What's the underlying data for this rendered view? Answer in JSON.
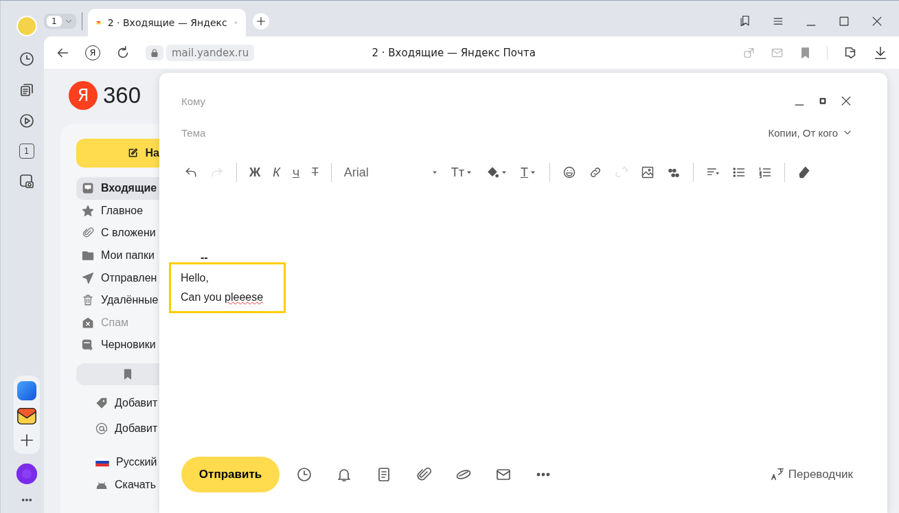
{
  "rail": {
    "top": [
      {
        "kind": "avatar"
      },
      {
        "kind": "clock"
      },
      {
        "kind": "tabs"
      },
      {
        "kind": "play"
      },
      {
        "kind": "counter",
        "label": "1"
      },
      {
        "kind": "screenshot"
      }
    ],
    "bottom": [
      {
        "kind": "app-blue"
      },
      {
        "kind": "app-mail"
      },
      {
        "kind": "plus"
      }
    ],
    "assistant": {
      "kind": "assistant"
    },
    "more": {
      "kind": "dots"
    }
  },
  "tab_strip": {
    "tab_count": "1",
    "tabs": [
      {
        "title": "2 · Входящие — Яндекс",
        "selected": true
      }
    ]
  },
  "address_bar": {
    "search_label": "Я",
    "url": "mail.yandex.ru",
    "page_title": "2 · Входящие — Яндекс Почта"
  },
  "logo": {
    "mark": "Я",
    "text": "360"
  },
  "sidebar": {
    "compose_button": "На",
    "folders": [
      {
        "label": "Входящие",
        "kind": "inbox",
        "selected": true,
        "muted": false
      },
      {
        "label": "Главное",
        "kind": "star",
        "selected": false,
        "muted": false
      },
      {
        "label": "С вложени",
        "kind": "clip",
        "selected": false,
        "muted": false
      },
      {
        "label": "Мои папки",
        "kind": "folder",
        "selected": false,
        "muted": false
      },
      {
        "label": "Отправлен",
        "kind": "send",
        "selected": false,
        "muted": false
      },
      {
        "label": "Удалённые",
        "kind": "trash",
        "selected": false,
        "muted": false
      },
      {
        "label": "Спам",
        "kind": "spam",
        "selected": false,
        "muted": true
      },
      {
        "label": "Черновики",
        "kind": "drafts",
        "selected": false,
        "muted": false
      }
    ],
    "extras": [
      {
        "label": "Добавит",
        "kind": "tag"
      },
      {
        "label": "Добавит",
        "kind": "at"
      }
    ],
    "links": [
      {
        "label": "Русский",
        "kind": "flag"
      },
      {
        "label": "Скачать",
        "kind": "android"
      }
    ]
  },
  "compose": {
    "to": {
      "placeholder": "Кому"
    },
    "subject": {
      "placeholder": "Тема"
    },
    "cc_toggle": "Копии, От кого",
    "toolbar": [
      [
        {
          "kind": "undo",
          "disabled": false
        },
        {
          "kind": "redo",
          "disabled": true
        }
      ],
      [
        {
          "kind": "bold",
          "label": "Ж",
          "disabled": false
        },
        {
          "kind": "italic",
          "label": "К",
          "disabled": false
        },
        {
          "kind": "underline",
          "label": "Ч",
          "disabled": false
        },
        {
          "kind": "strike",
          "label": "Т",
          "disabled": false
        }
      ],
      [
        {
          "kind": "font",
          "label": "Arial",
          "disabled": false
        },
        {
          "kind": "size",
          "label": "Tт",
          "disabled": false
        },
        {
          "kind": "fill",
          "disabled": false
        },
        {
          "kind": "text-color",
          "label": "T",
          "disabled": false
        }
      ],
      [
        {
          "kind": "emoji",
          "disabled": false
        },
        {
          "kind": "link",
          "disabled": false
        },
        {
          "kind": "unlink",
          "disabled": true
        },
        {
          "kind": "image",
          "disabled": false
        },
        {
          "kind": "quote",
          "disabled": false
        }
      ],
      [
        {
          "kind": "align",
          "disabled": false
        },
        {
          "kind": "bullets",
          "disabled": false
        },
        {
          "kind": "numbers",
          "disabled": false
        }
      ],
      [
        {
          "kind": "eraser",
          "disabled": false
        }
      ]
    ],
    "body": {
      "signature_dash": "--",
      "highlighted": true,
      "lines": [
        [
          {
            "text": "Hello,",
            "misspelled": false
          }
        ],
        [
          {
            "text": "Can you ",
            "misspelled": false
          },
          {
            "text": "pleeese",
            "misspelled": true
          }
        ]
      ]
    },
    "send_button": "Отправить",
    "actions": [
      {
        "kind": "clock"
      },
      {
        "kind": "bell"
      },
      {
        "kind": "doc"
      },
      {
        "kind": "clip"
      },
      {
        "kind": "planet"
      },
      {
        "kind": "mail"
      },
      {
        "kind": "dots"
      }
    ],
    "translator": "Переводчик"
  }
}
